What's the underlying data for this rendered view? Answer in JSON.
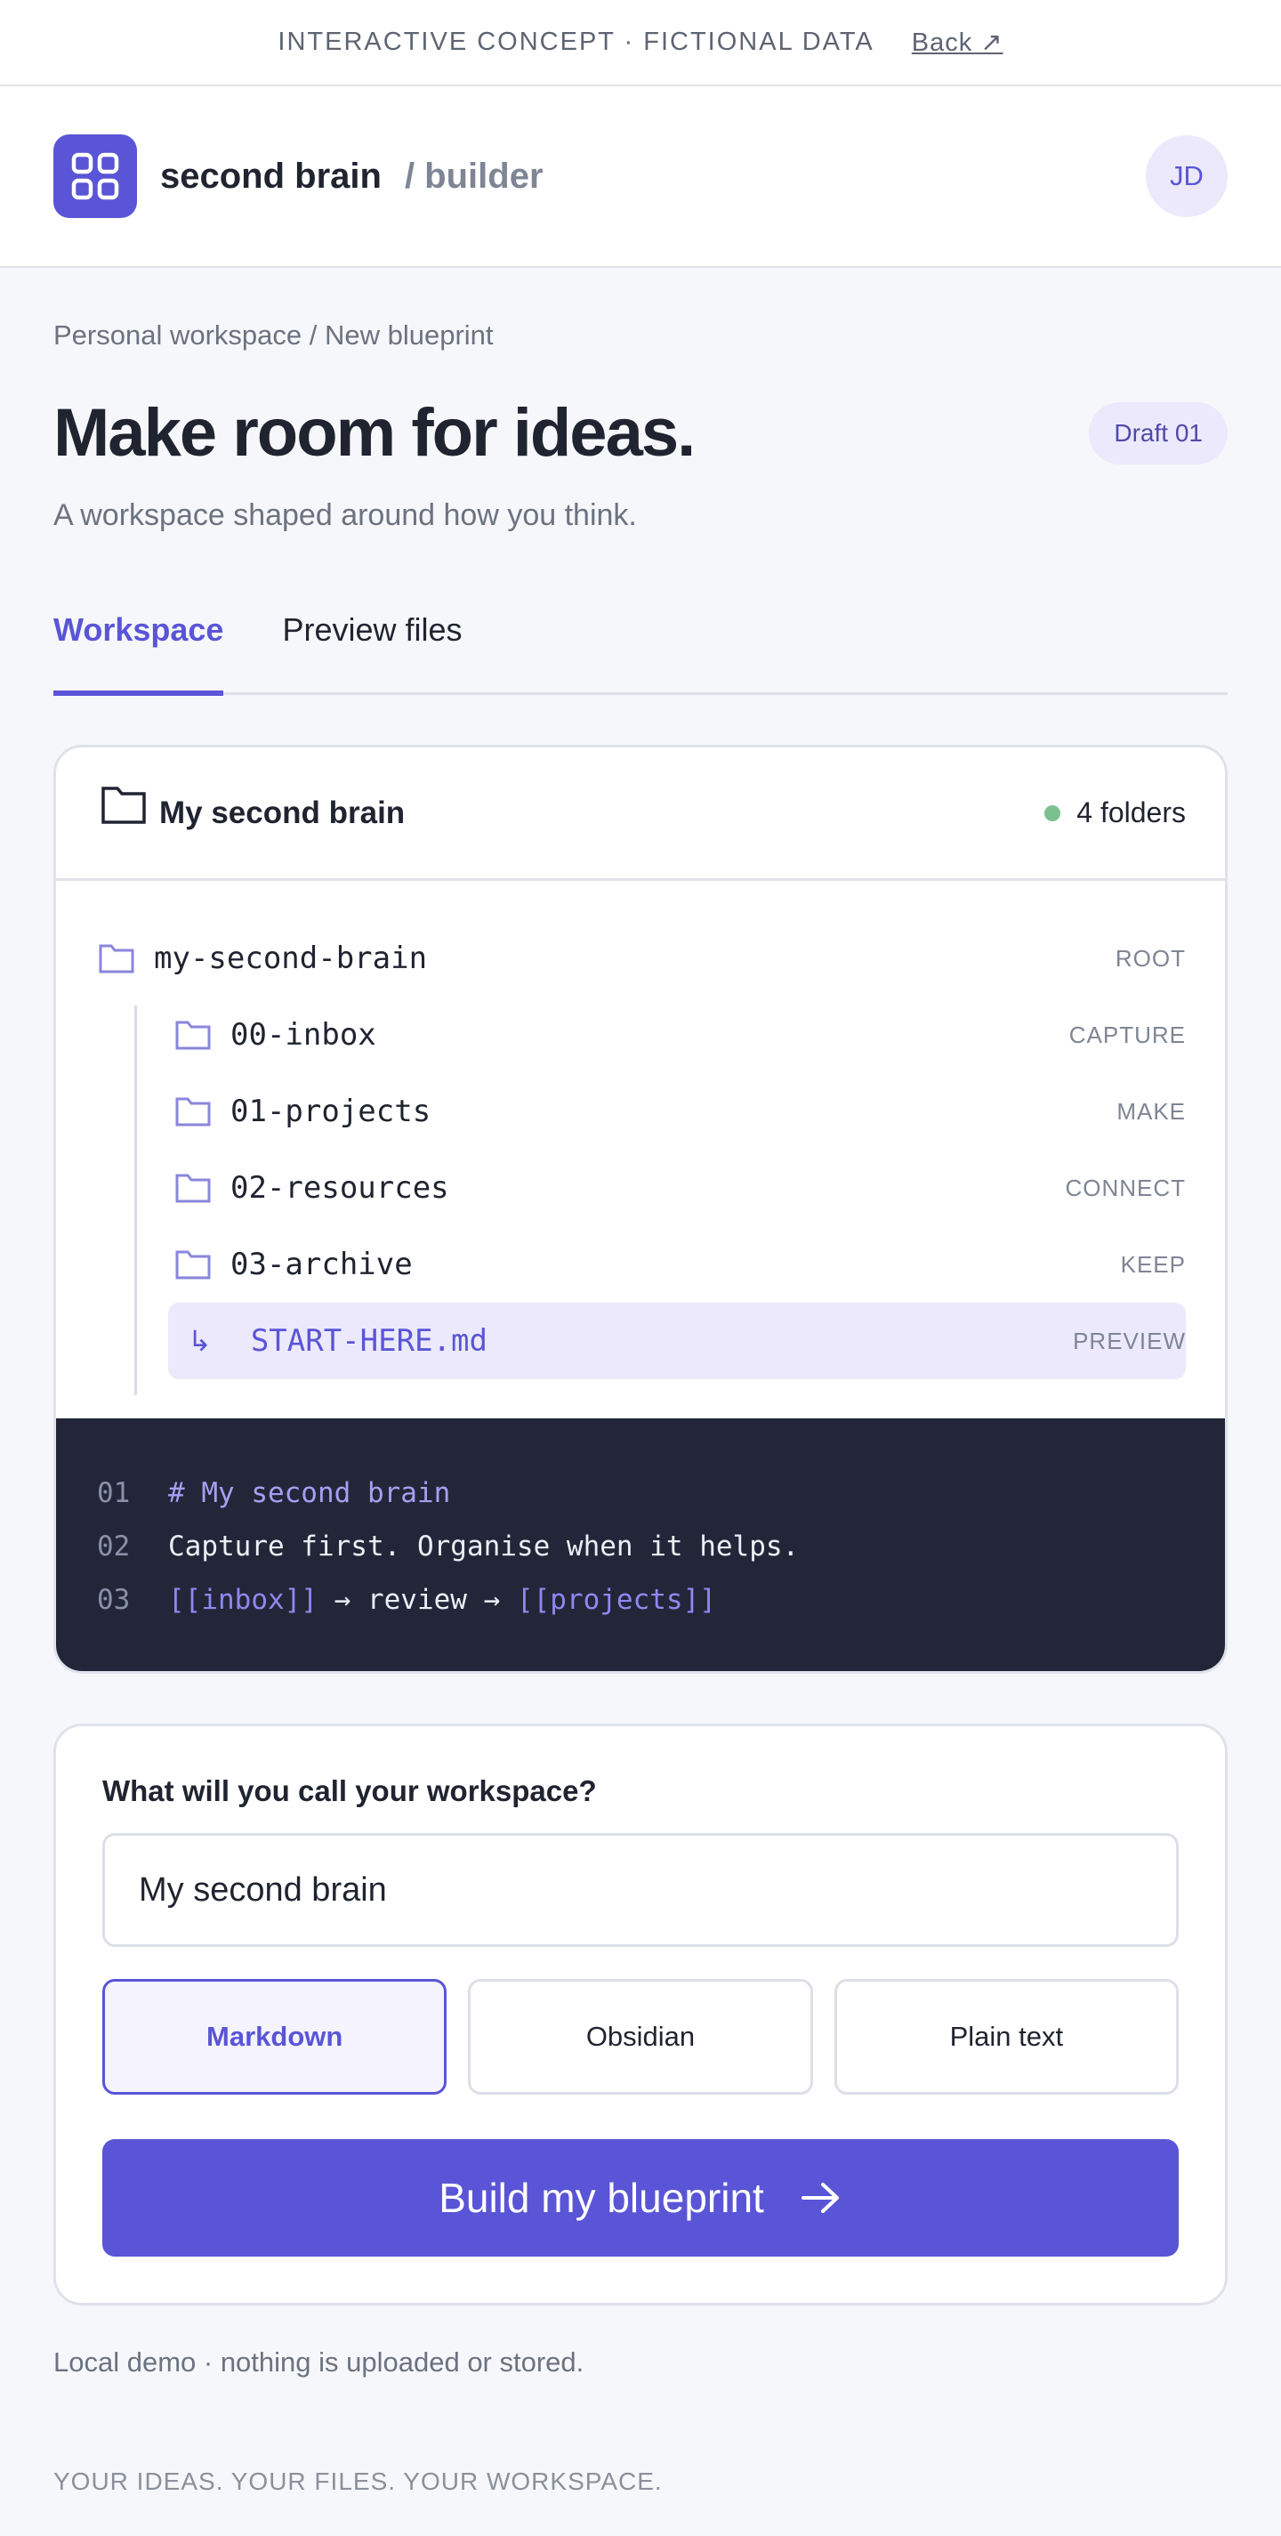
{
  "banner": {
    "text": "INTERACTIVE CONCEPT · FICTIONAL DATA",
    "back_label": "Back ↗"
  },
  "header": {
    "brand_name": "second brain",
    "brand_sub": "/ builder",
    "avatar_initials": "JD",
    "logo_icon": "grid-icon"
  },
  "breadcrumb": "Personal workspace / New blueprint",
  "page": {
    "title": "Make room for ideas.",
    "subtitle": "A workspace shaped around how you think.",
    "draft_badge": "Draft 01"
  },
  "tabs": [
    {
      "label": "Workspace",
      "active": true
    },
    {
      "label": "Preview files",
      "active": false
    }
  ],
  "tree_card": {
    "title": "My second brain",
    "folder_count": "4 folders",
    "status_color": "#7cc08f",
    "root": {
      "name": "my-second-brain",
      "tag": "ROOT"
    },
    "folders": [
      {
        "name": "00-inbox",
        "tag": "CAPTURE"
      },
      {
        "name": "01-projects",
        "tag": "MAKE"
      },
      {
        "name": "02-resources",
        "tag": "CONNECT"
      },
      {
        "name": "03-archive",
        "tag": "KEEP"
      }
    ],
    "file": {
      "arrow": "↳",
      "name": "START-HERE.md",
      "tag": "PREVIEW"
    }
  },
  "code_preview": {
    "lines": [
      {
        "num": "01",
        "text": "# My second brain"
      },
      {
        "num": "02",
        "text": "Capture first. Organise when it helps."
      },
      {
        "num": "03",
        "link1": "[[inbox]]",
        "mid": " → review → ",
        "link2": "[[projects]]"
      }
    ]
  },
  "form": {
    "label": "What will you call your workspace?",
    "input_value": "My second brain",
    "formats": [
      {
        "label": "Markdown",
        "selected": true
      },
      {
        "label": "Obsidian",
        "selected": false
      },
      {
        "label": "Plain text",
        "selected": false
      }
    ],
    "build_label": "Build my blueprint"
  },
  "note": "Local demo · nothing is uploaded or stored.",
  "footer_tagline": "YOUR IDEAS. YOUR FILES. YOUR WORKSPACE.",
  "colors": {
    "accent": "#5a55d6",
    "accent_soft": "#ebe9fb",
    "code_bg": "#222638"
  }
}
